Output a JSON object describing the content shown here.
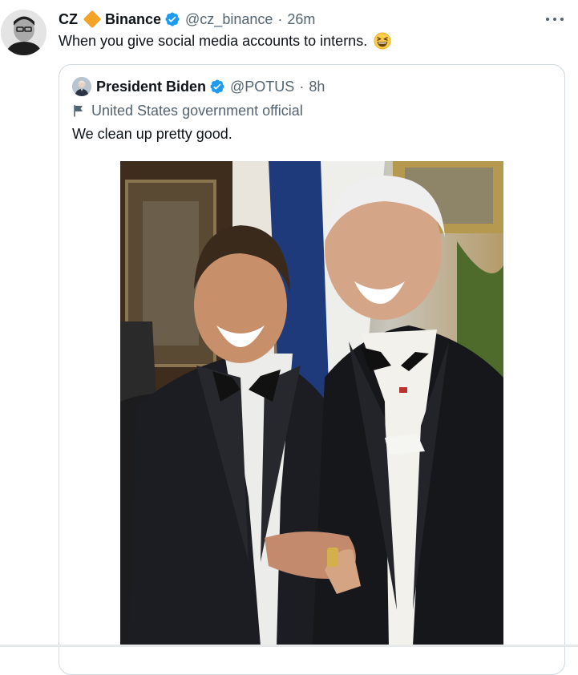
{
  "tweet": {
    "author_name": "CZ",
    "affiliation_name": "Binance",
    "handle": "@cz_binance",
    "separator": "·",
    "time": "26m",
    "text": "When you give social media accounts to interns.",
    "emoji_icon": "grinning-squinting-face",
    "more_icon": "more-horizontal-icon"
  },
  "quote": {
    "author_name": "President Biden",
    "handle": "@POTUS",
    "separator": "·",
    "time": "8h",
    "label": "United States government official",
    "label_icon": "flag-icon",
    "text": "We clean up pretty good.",
    "photo_icon": "photo"
  },
  "colors": {
    "text_primary": "#0f1419",
    "text_secondary": "#536471",
    "verified_blue": "#1d9bf0",
    "binance_orange": "#f3a426",
    "border": "#cfd9de"
  }
}
